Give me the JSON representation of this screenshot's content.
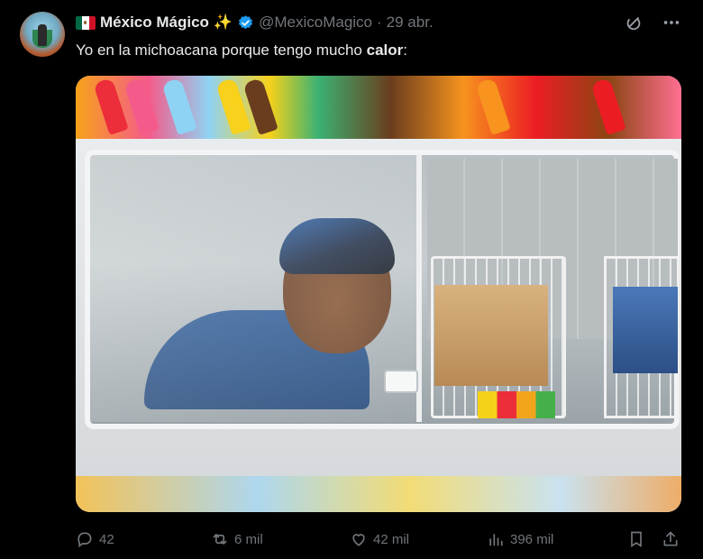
{
  "author": {
    "name": "México Mágico",
    "handle": "@MexicoMagico",
    "separator": "·",
    "date": "29 abr."
  },
  "tweet": {
    "text_before": "Yo en la michoacana porque tengo mucho ",
    "text_bold": "calor",
    "text_after": ":"
  },
  "actions": {
    "replies": "42",
    "reposts": "6 mil",
    "likes": "42 mil",
    "views": "396 mil"
  },
  "icons": {
    "grok": "grok-icon",
    "more": "more-icon",
    "reply": "reply-icon",
    "repost": "repost-icon",
    "like": "heart-icon",
    "views": "views-icon",
    "bookmark": "bookmark-icon",
    "share": "share-icon"
  },
  "colors": {
    "background": "#000000",
    "text": "#e7e9ea",
    "muted": "#71767b",
    "verified": "#1d9bf0"
  }
}
